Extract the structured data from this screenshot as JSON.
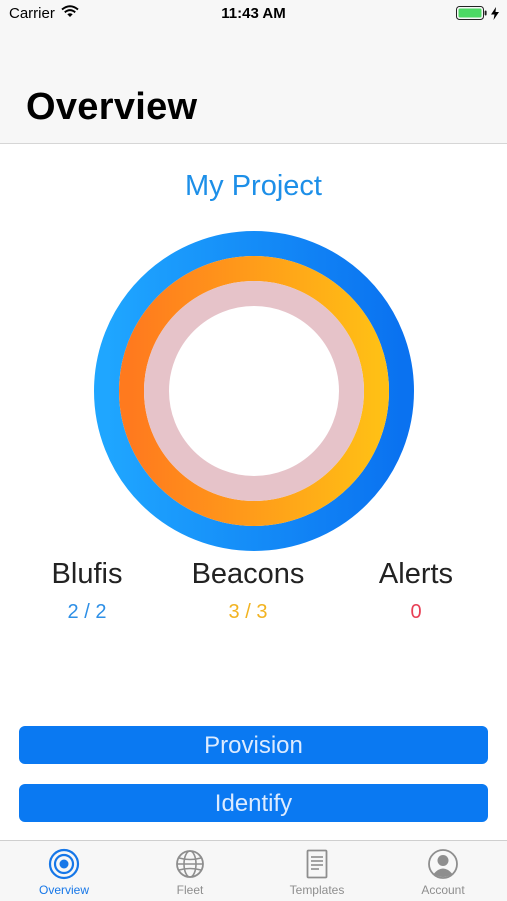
{
  "status_bar": {
    "carrier": "Carrier",
    "time": "11:43 AM"
  },
  "nav": {
    "title": "Overview"
  },
  "project": {
    "name": "My Project"
  },
  "rings": {
    "outer_colors": [
      "#1fa6ff",
      "#0a72f0"
    ],
    "middle_colors": [
      "#ff7a1e",
      "#ffbf15"
    ],
    "inner_color": "#e6c3c9"
  },
  "stats": {
    "blufis": {
      "label": "Blufis",
      "value": "2 / 2",
      "color": "#2d8fe6"
    },
    "beacons": {
      "label": "Beacons",
      "value": "3 / 3",
      "color": "#f2b320"
    },
    "alerts": {
      "label": "Alerts",
      "value": "0",
      "color": "#e83f55"
    }
  },
  "buttons": {
    "provision": "Provision",
    "identify": "Identify"
  },
  "tabs": [
    {
      "label": "Overview",
      "icon": "target-icon",
      "active": true
    },
    {
      "label": "Fleet",
      "icon": "globe-icon",
      "active": false
    },
    {
      "label": "Templates",
      "icon": "document-icon",
      "active": false
    },
    {
      "label": "Account",
      "icon": "user-icon",
      "active": false
    }
  ]
}
